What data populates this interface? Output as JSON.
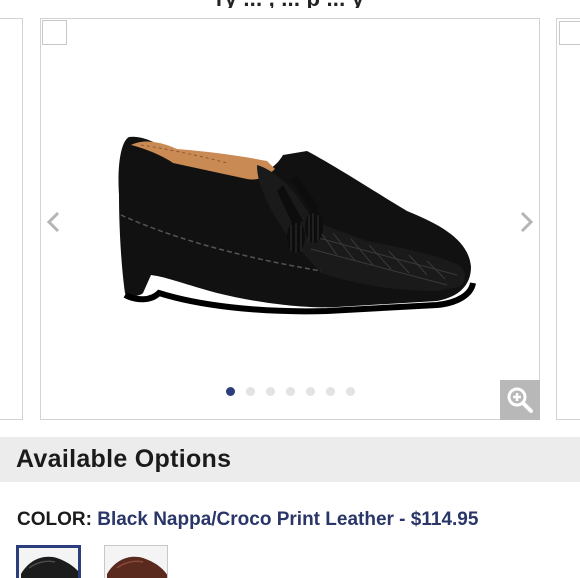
{
  "header": {
    "cut_text": "ry ... , ... p ... y"
  },
  "carousel": {
    "slide_count": 7,
    "active_index": 0
  },
  "options": {
    "title": "Available Options",
    "color_label": "COLOR:",
    "color_value": "Black Nappa/Croco Print Leather - $114.95"
  },
  "swatches": [
    {
      "name": "Black",
      "color": "#1c1c1c",
      "selected": true
    },
    {
      "name": "Brown",
      "color": "#5a2a1f",
      "selected": false
    }
  ],
  "colors": {
    "accent": "#2b3d7a",
    "zoom_bg": "#b8b8b8",
    "options_bar_bg": "#ececec"
  }
}
